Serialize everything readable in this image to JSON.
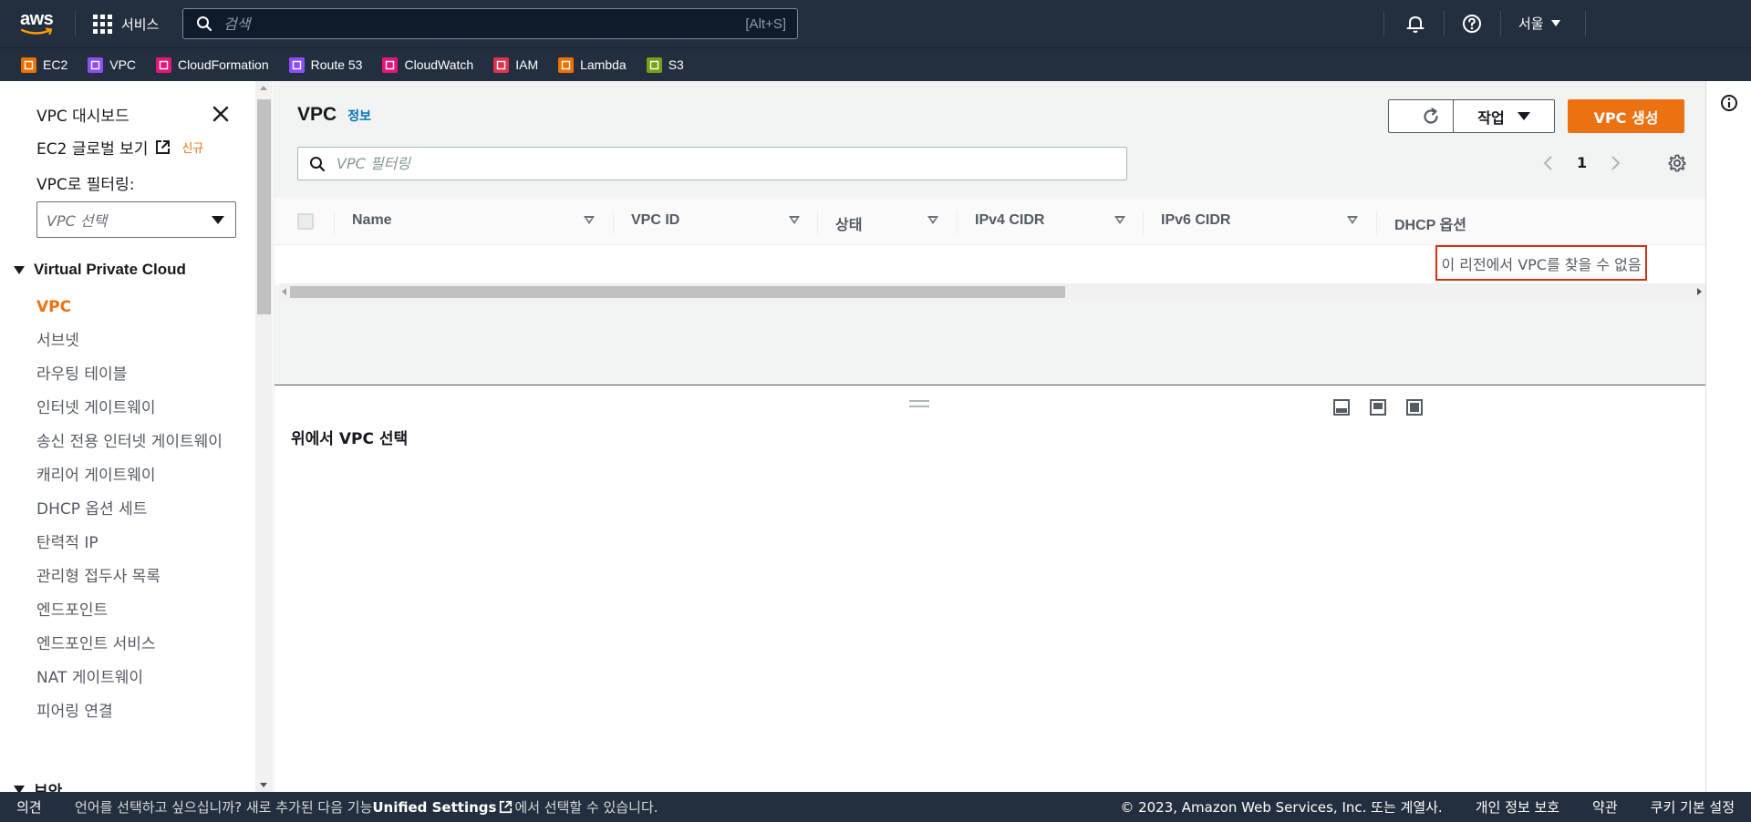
{
  "topnav": {
    "logo_text": "aws",
    "services_label": "서비스",
    "search_placeholder": "검색",
    "search_shortcut": "[Alt+S]",
    "region_label": "서울"
  },
  "favorites": [
    {
      "label": "EC2",
      "color": "#ed7100"
    },
    {
      "label": "VPC",
      "color": "#8c4fff"
    },
    {
      "label": "CloudFormation",
      "color": "#e7157b"
    },
    {
      "label": "Route 53",
      "color": "#8c4fff"
    },
    {
      "label": "CloudWatch",
      "color": "#e7157b"
    },
    {
      "label": "IAM",
      "color": "#dd344c"
    },
    {
      "label": "Lambda",
      "color": "#ed7100"
    },
    {
      "label": "S3",
      "color": "#7aa116"
    }
  ],
  "sidebar": {
    "dashboard_label": "VPC 대시보드",
    "global_view_label": "EC2 글로벌 보기",
    "new_badge": "신규",
    "filter_label": "VPC로 필터링:",
    "filter_placeholder": "VPC 선택",
    "section_title": "Virtual Private Cloud",
    "items": [
      {
        "label": "VPC"
      },
      {
        "label": "서브넷"
      },
      {
        "label": "라우팅 테이블"
      },
      {
        "label": "인터넷 게이트웨이"
      },
      {
        "label": "송신 전용 인터넷 게이트웨이"
      },
      {
        "label": "캐리어 게이트웨이"
      },
      {
        "label": "DHCP 옵션 세트"
      },
      {
        "label": "탄력적 IP"
      },
      {
        "label": "관리형 접두사 목록"
      },
      {
        "label": "엔드포인트"
      },
      {
        "label": "엔드포인트 서비스"
      },
      {
        "label": "NAT 게이트웨이"
      },
      {
        "label": "피어링 연결"
      }
    ],
    "next_section_partial": "보안"
  },
  "main": {
    "title": "VPC",
    "info_link": "정보",
    "actions_label": "작업",
    "create_label": "VPC 생성",
    "filter_placeholder": "VPC 필터링",
    "page_number": "1",
    "columns": [
      "Name",
      "VPC ID",
      "상태",
      "IPv4 CIDR",
      "IPv6 CIDR",
      "DHCP 옵션"
    ],
    "empty_message": "이 리전에서 VPC를 찾을 수 없음",
    "details_prompt": "위에서 VPC 선택"
  },
  "footer": {
    "feedback": "의견",
    "message_prefix": "언어를 선택하고 싶으십니까? 새로 추가된 다음 기능",
    "message_link": "Unified Settings",
    "message_suffix": "에서 선택할 수 있습니다.",
    "copyright": "© 2023, Amazon Web Services, Inc. 또는 계열사.",
    "privacy": "개인 정보 보호",
    "terms": "약관",
    "cookies": "쿠키 기본 설정"
  }
}
